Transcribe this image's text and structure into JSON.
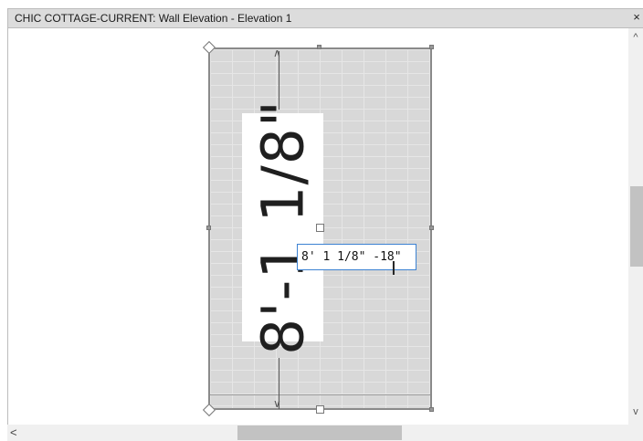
{
  "window": {
    "title": "CHIC COTTAGE-CURRENT: Wall Elevation - Elevation 1",
    "close_label": "×"
  },
  "dimension": {
    "display_text": "8'-1 1/8\""
  },
  "edit_field": {
    "value": "8' 1 1/8\" -18\""
  },
  "scrollbars": {
    "up_arrow": "^",
    "down_arrow": "v",
    "left_arrow": "<"
  },
  "icons": {
    "grip": "grip-handle-icon",
    "cursor": "text-cursor-icon"
  }
}
